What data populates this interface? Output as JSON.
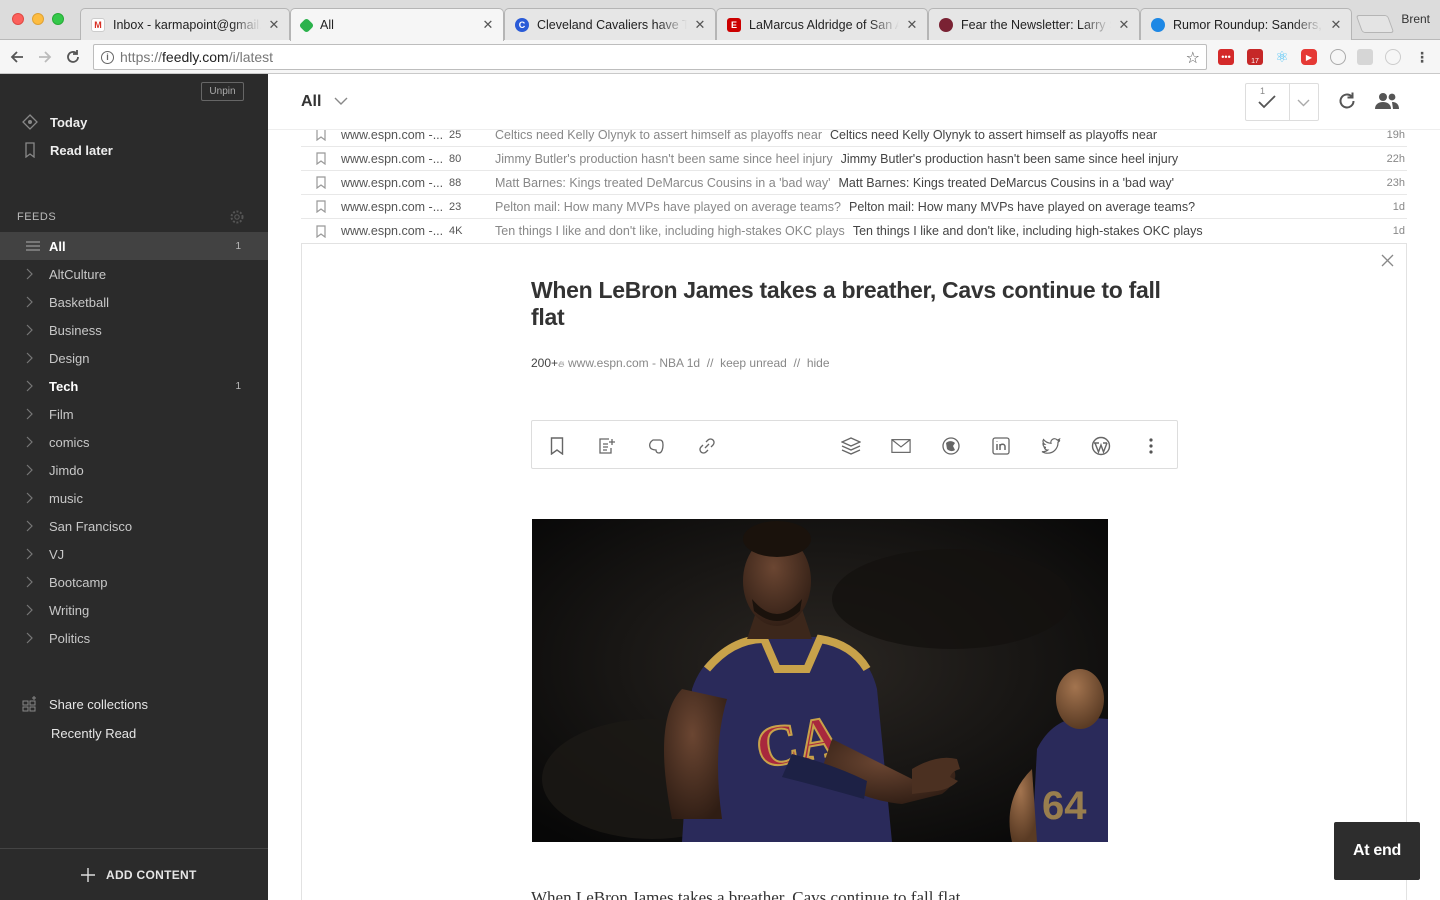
{
  "browser": {
    "tabs": [
      {
        "title": "Inbox - karmapoint@gmail.com",
        "favicon": "gmail-icon"
      },
      {
        "title": "All",
        "favicon": "feedly-icon"
      },
      {
        "title": "Cleveland Cavaliers have Team",
        "favicon": "chrome-icon"
      },
      {
        "title": "LaMarcus Aldridge of San Antonio",
        "favicon": "espn-icon"
      },
      {
        "title": "Fear the Newsletter: Larry Sanders",
        "favicon": "sbnation-icon"
      },
      {
        "title": "Rumor Roundup: Sanders, Cavs",
        "favicon": "globe-icon"
      }
    ],
    "profile_name": "Brent",
    "url": {
      "scheme": "https://",
      "host": "feedly.com",
      "path": "/i/latest"
    },
    "ext_calendar_badge": "17"
  },
  "sidebar": {
    "unpin_label": "Unpin",
    "today_label": "Today",
    "read_later_label": "Read later",
    "feeds_header": "FEEDS",
    "feeds": [
      {
        "label": "All",
        "count": "1"
      },
      {
        "label": "AltCulture",
        "count": ""
      },
      {
        "label": "Basketball",
        "count": ""
      },
      {
        "label": "Business",
        "count": ""
      },
      {
        "label": "Design",
        "count": ""
      },
      {
        "label": "Tech",
        "count": "1"
      },
      {
        "label": "Film",
        "count": ""
      },
      {
        "label": "comics",
        "count": ""
      },
      {
        "label": "Jimdo",
        "count": ""
      },
      {
        "label": "music",
        "count": ""
      },
      {
        "label": "San Francisco",
        "count": ""
      },
      {
        "label": "VJ",
        "count": ""
      },
      {
        "label": "Bootcamp",
        "count": ""
      },
      {
        "label": "Writing",
        "count": ""
      },
      {
        "label": "Politics",
        "count": ""
      }
    ],
    "share_collections_label": "Share collections",
    "recently_read_label": "Recently Read",
    "add_content_label": "ADD CONTENT"
  },
  "header": {
    "title": "All",
    "markread_count": "1"
  },
  "rows": [
    {
      "source": "www.espn.com -...",
      "engagement": "25",
      "title": "Celtics need Kelly Olynyk to assert himself as playoffs near",
      "summary": "Celtics need Kelly Olynyk to assert himself as playoffs near",
      "age": "19h"
    },
    {
      "source": "www.espn.com -...",
      "engagement": "80",
      "title": "Jimmy Butler's production hasn't been same since heel injury",
      "summary": "Jimmy Butler's production hasn't been same since heel injury",
      "age": "22h"
    },
    {
      "source": "www.espn.com -...",
      "engagement": "88",
      "title": "Matt Barnes: Kings treated DeMarcus Cousins in a 'bad way'",
      "summary": "Matt Barnes: Kings treated DeMarcus Cousins in a 'bad way'",
      "age": "23h"
    },
    {
      "source": "www.espn.com -...",
      "engagement": "23",
      "title": "Pelton mail: How many MVPs have played on average teams?",
      "summary": "Pelton mail: How many MVPs have played on average teams?",
      "age": "1d"
    },
    {
      "source": "www.espn.com -...",
      "engagement": "4K",
      "title": "Ten things I like and don't like, including high-stakes OKC plays",
      "summary": "Ten things I like and don't like, including high-stakes OKC plays",
      "age": "1d"
    }
  ],
  "article": {
    "title": "When LeBron James takes a breather, Cavs continue to fall flat",
    "engagement": "200+",
    "source": "www.espn.com - NBA",
    "age": "1d",
    "separator": "//",
    "keep_unread_label": "keep unread",
    "hide_label": "hide",
    "body_preview": "When LeBron James takes a breather, Cavs continue to fall flat"
  },
  "at_end_label": "At end",
  "colors": {
    "sidebar_bg": "#2b2b2b",
    "sidebar_active": "#424242",
    "feedly_green": "#2bb24c",
    "toast_bg": "#2d2d2d"
  }
}
